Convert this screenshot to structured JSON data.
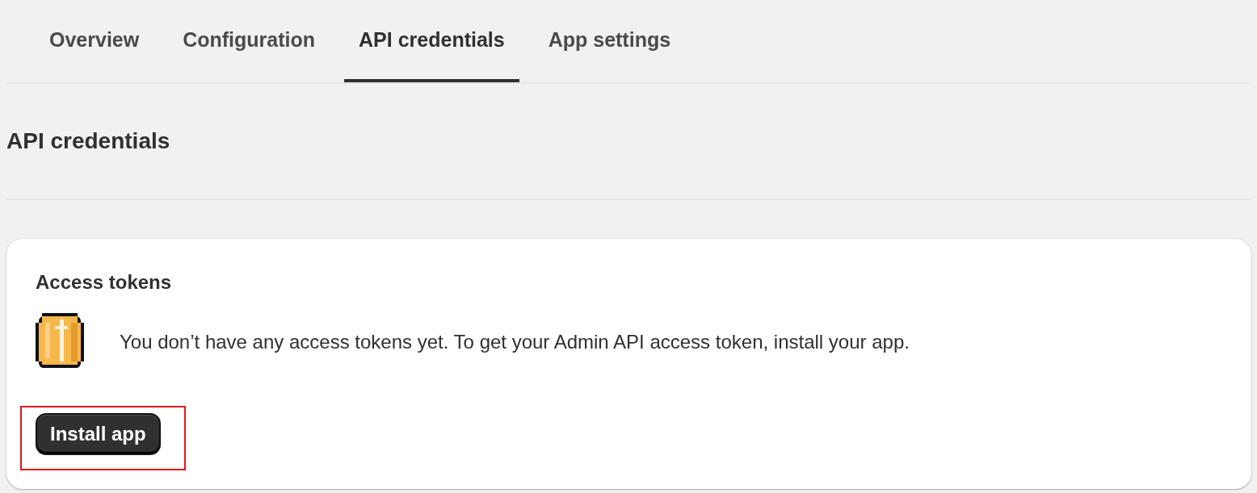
{
  "tabs": [
    {
      "label": "Overview",
      "selected": false
    },
    {
      "label": "Configuration",
      "selected": false
    },
    {
      "label": "API credentials",
      "selected": true
    },
    {
      "label": "App settings",
      "selected": false
    }
  ],
  "heading": "API credentials",
  "card": {
    "title": "Access tokens",
    "message": "You don’t have any access tokens yet. To get your Admin API access token, install your app.",
    "button": {
      "label": "Install app",
      "highlighted": true
    }
  }
}
